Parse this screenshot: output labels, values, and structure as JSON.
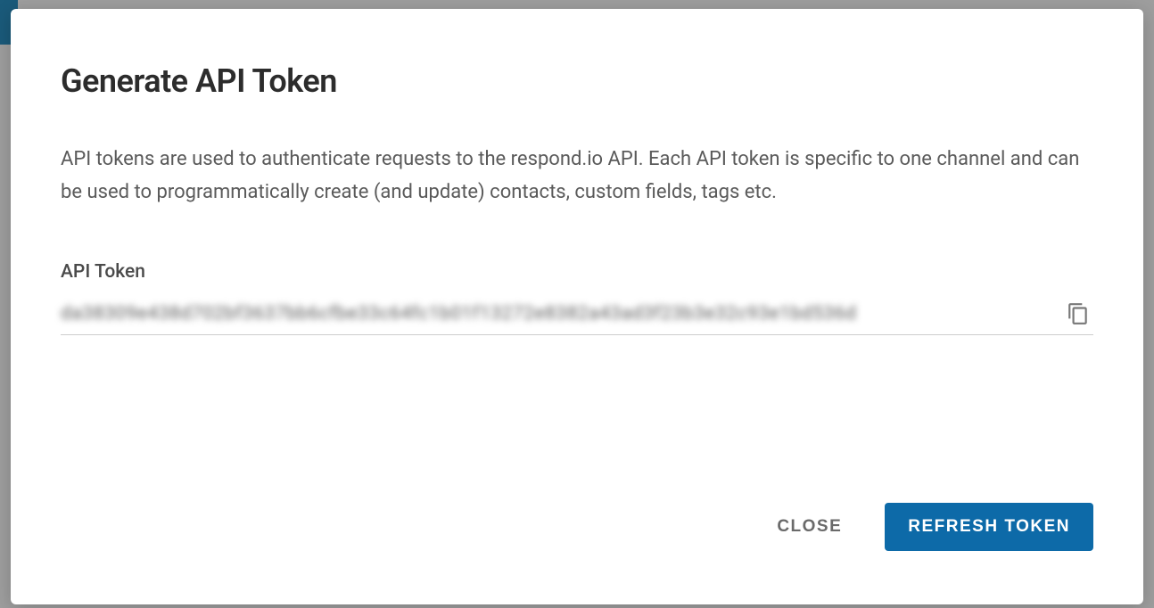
{
  "modal": {
    "title": "Generate API Token",
    "description": "API tokens are used to authenticate requests to the respond.io API. Each API token is specific to one channel and can be used to programmatically create (and update) contacts, custom fields, tags etc.",
    "field_label": "API Token",
    "token_value": "da38309e438d702bf3637bb6cfbe33c64fc1b01f13272e8382a43ad3f23b3e32c93e1bd536d",
    "actions": {
      "close_label": "CLOSE",
      "refresh_label": "REFRESH TOKEN"
    }
  }
}
